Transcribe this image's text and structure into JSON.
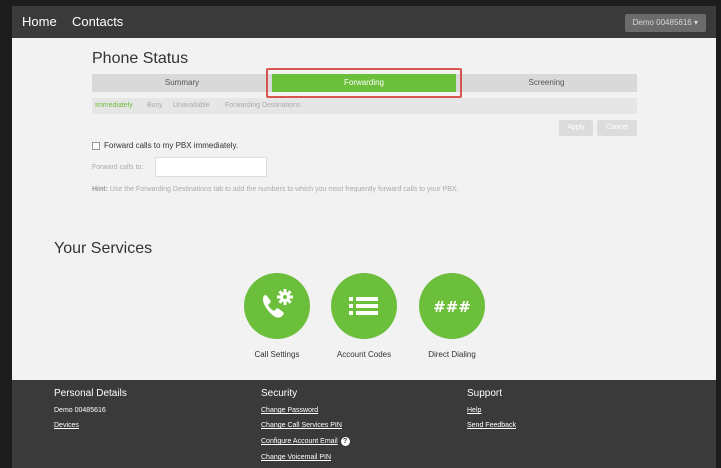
{
  "nav": {
    "home": "Home",
    "contacts": "Contacts",
    "account": "Demo 00485616 ▾"
  },
  "phone_status": {
    "title": "Phone Status",
    "tabs": [
      "Summary",
      "Forwarding",
      "Screening"
    ],
    "active_tab": "Forwarding",
    "subtabs": [
      "Immediately",
      "Busy",
      "Unavailable",
      "Forwarding Destinations"
    ],
    "active_subtab": "Immediately",
    "apply": "Apply",
    "cancel": "Cancel",
    "checkbox_label": "Forward calls to my PBX immediately.",
    "forward_label": "Forward calls to:",
    "hint_bold": "Hint:",
    "hint_text": "Use the Forwarding Destinations tab to add the numbers to which you most frequently forward calls to your PBX."
  },
  "services": {
    "title": "Your Services",
    "items": [
      {
        "label": "Call Settings",
        "icon": "phone-gear-icon"
      },
      {
        "label": "Account Codes",
        "icon": "list-icon"
      },
      {
        "label": "Direct Dialing",
        "icon": "hash-icon"
      }
    ]
  },
  "footer": {
    "personal": {
      "title": "Personal Details",
      "name": "Demo 00485616",
      "devices": "Devices"
    },
    "security": {
      "title": "Security",
      "links": [
        "Change Password",
        "Change Call Services PIN",
        "Configure Account Email",
        "Change Voicemail PIN"
      ]
    },
    "support": {
      "title": "Support",
      "links": [
        "Help",
        "Send Feedback"
      ]
    }
  },
  "colors": {
    "accent": "#6bbf3b",
    "highlight": "#d9534f",
    "nav_bg": "#3a3a3a"
  }
}
